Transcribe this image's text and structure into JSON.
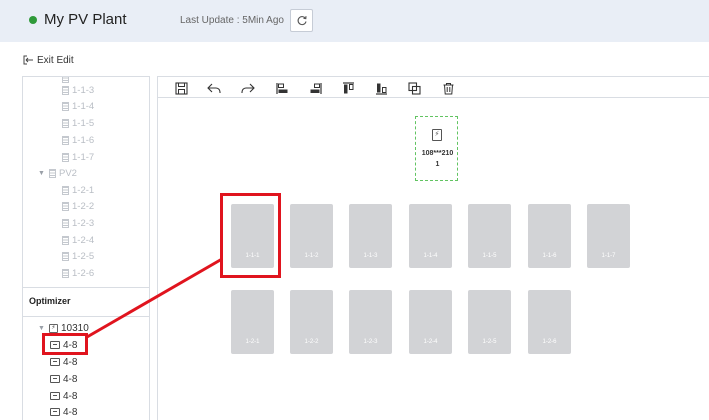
{
  "header": {
    "plant_name": "My PV Plant",
    "last_update": "Last Update : 5Min Ago",
    "status_color": "#2f9a3a",
    "refresh_icon": "refresh-icon"
  },
  "exit_edit": {
    "label": "Exit Edit",
    "icon": "exit-icon"
  },
  "tree": {
    "items": [
      {
        "label": "1-1-3"
      },
      {
        "label": "1-1-4"
      },
      {
        "label": "1-1-5"
      },
      {
        "label": "1-1-6"
      },
      {
        "label": "1-1-7"
      },
      {
        "label": "PV2"
      },
      {
        "label": "1-2-1"
      },
      {
        "label": "1-2-2"
      },
      {
        "label": "1-2-3"
      },
      {
        "label": "1-2-4"
      },
      {
        "label": "1-2-5"
      },
      {
        "label": "1-2-6"
      }
    ]
  },
  "optimizer": {
    "title": "Optimizer",
    "root_label": "10310",
    "items": [
      {
        "label": "4-8"
      },
      {
        "label": "4-8"
      },
      {
        "label": "4-8"
      },
      {
        "label": "4-8"
      },
      {
        "label": "4-8"
      }
    ]
  },
  "toolbar": {
    "tools": [
      "save-icon",
      "undo-icon",
      "redo-icon",
      "align-left-icon",
      "align-right-icon",
      "align-top-icon",
      "align-bottom-icon",
      "copy-icon",
      "delete-icon"
    ]
  },
  "inverter": {
    "sn_line1": "108***210",
    "sn_line2": "1"
  },
  "panels": {
    "row1": [
      "1-1-1",
      "1-1-2",
      "1-1-3",
      "1-1-4",
      "1-1-5",
      "1-1-6",
      "1-1-7"
    ],
    "row2": [
      "1-2-1",
      "1-2-2",
      "1-2-3",
      "1-2-4",
      "1-2-5",
      "1-2-6"
    ]
  },
  "annotation": {
    "color": "#e0141e"
  }
}
